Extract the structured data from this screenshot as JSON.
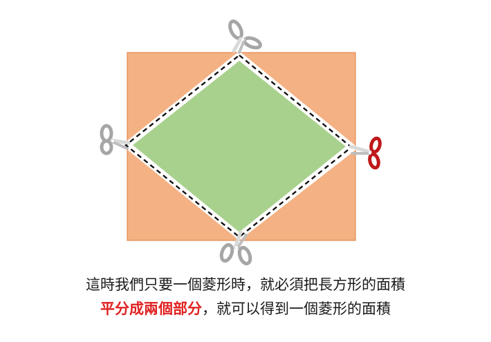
{
  "caption": {
    "line1": "這時我們只要一個菱形時，就必須把長方形的面積",
    "line2_highlight": "平分成兩個部分",
    "line2_rest": "，就可以得到一個菱形的面積"
  },
  "colors": {
    "rectangle": "#f4b183",
    "rectangle_border": "#e07b3c",
    "rhombus": "#a9d18e",
    "cut_line": "#111111",
    "scissors_gray": "#a6a6a6",
    "scissors_red": "#c0181b",
    "highlight_text": "#e02020"
  },
  "icons": [
    "scissors-icon-top",
    "scissors-icon-left",
    "scissors-icon-right",
    "scissors-icon-bottom"
  ]
}
